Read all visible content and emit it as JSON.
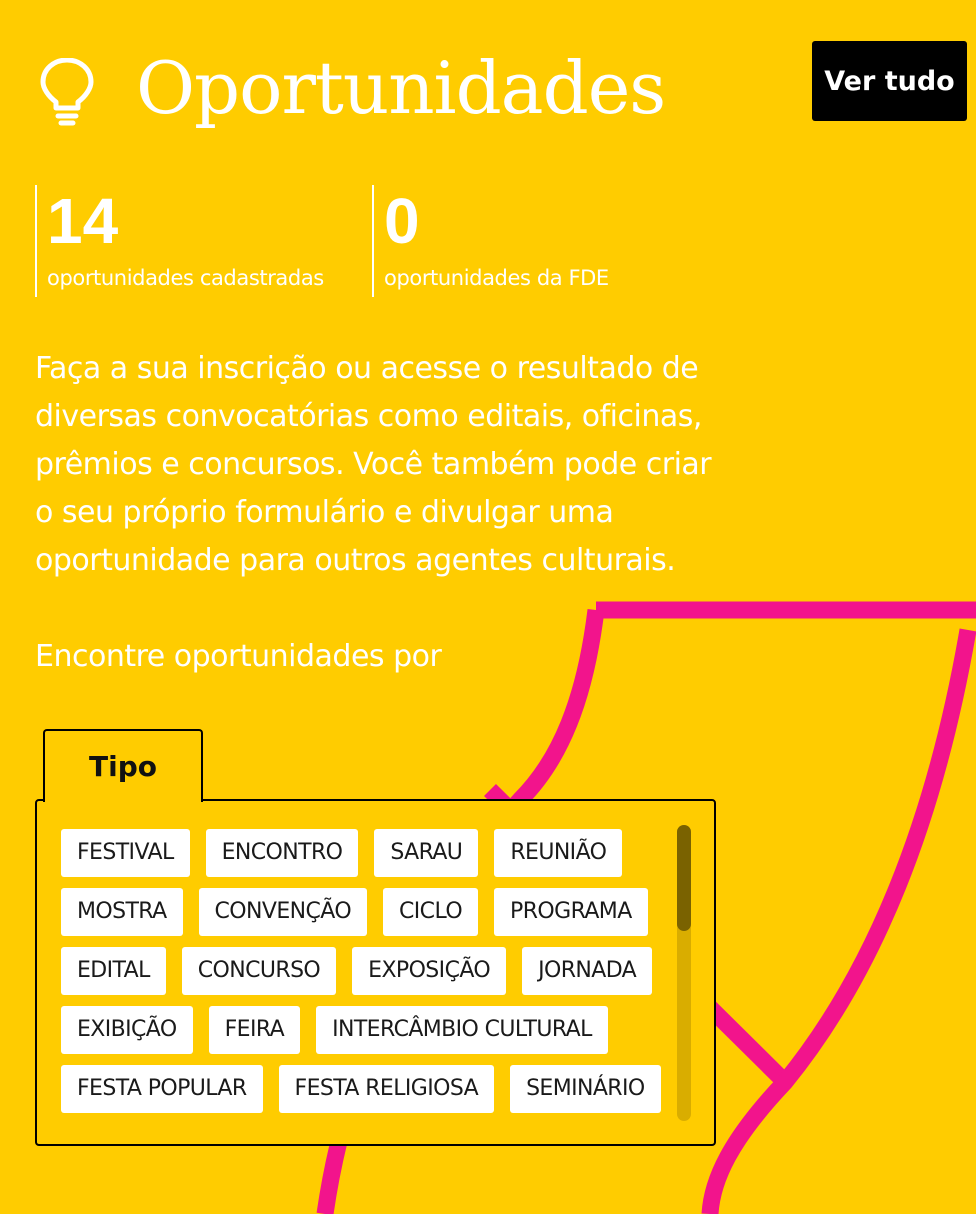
{
  "header": {
    "icon": "lightbulb-icon",
    "title": "Oportunidades",
    "see_all_label": "Ver tudo"
  },
  "stats": [
    {
      "value": "14",
      "label": "oportunidades cadastradas"
    },
    {
      "value": "0",
      "label": "oportunidades da FDE"
    }
  ],
  "intro": "Faça a sua inscrição ou acesse o resultado de diversas convocatórias como editais, oficinas, prêmios e concursos. Você também pode criar o seu próprio formulário e divulgar uma oportunidade para outros agentes culturais.",
  "filter": {
    "prompt": "Encontre oportunidades por",
    "active_tab": "Tipo",
    "tags": [
      [
        "FESTIVAL",
        "ENCONTRO",
        "SARAU",
        "REUNIÃO"
      ],
      [
        "MOSTRA",
        "CONVENÇÃO",
        "CICLO",
        "PROGRAMA"
      ],
      [
        "EDITAL",
        "CONCURSO",
        "EXPOSIÇÃO",
        "JORNADA"
      ],
      [
        "EXIBIÇÃO",
        "FEIRA",
        "INTERCÂMBIO CULTURAL"
      ],
      [
        "FESTA POPULAR",
        "FESTA RELIGIOSA",
        "SEMINÁRIO"
      ]
    ]
  },
  "colors": {
    "background": "#FFCC00",
    "decoration": "#F2148C",
    "button": "#000000",
    "text": "#FFFFFF"
  }
}
